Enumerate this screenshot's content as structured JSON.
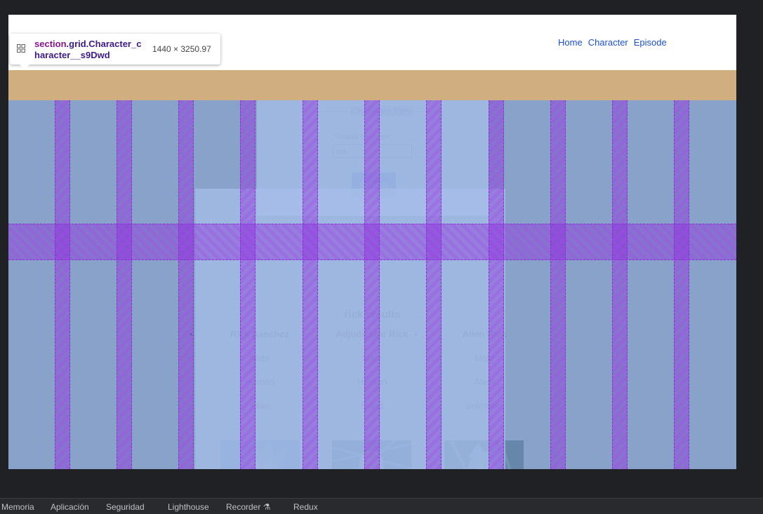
{
  "nav": {
    "home": "Home",
    "character": "Character",
    "episode": "Episode"
  },
  "form": {
    "legend": "Character form",
    "search_label": "*Search character",
    "search_value": "rick",
    "submit_label": "Submit"
  },
  "results": {
    "title": "rick results",
    "characters": [
      {
        "name": "Rick Sanchez",
        "gender": "Male",
        "species": "Human",
        "status": "Alive"
      },
      {
        "name": "Adjudicator Rick",
        "gender": "Male",
        "species": "Human",
        "status": "Dead"
      },
      {
        "name": "Alien Rick",
        "gender": "Male",
        "species": "Alien",
        "status": "unknown"
      }
    ]
  },
  "inspector": {
    "tag": "section",
    "selector": ".grid.Character_character__s9Dwd",
    "size": "1440 × 3250.97",
    "icon": "grid-layout-icon"
  },
  "devtools": {
    "tabs": [
      "Memoria",
      "Aplicación",
      "Seguridad",
      "Lighthouse",
      "Recorder",
      "Redux"
    ]
  },
  "colors": {
    "accent": "#1a4fd6",
    "margin_band": "#d0ae7f",
    "grid_overlay": "#9933e6"
  }
}
